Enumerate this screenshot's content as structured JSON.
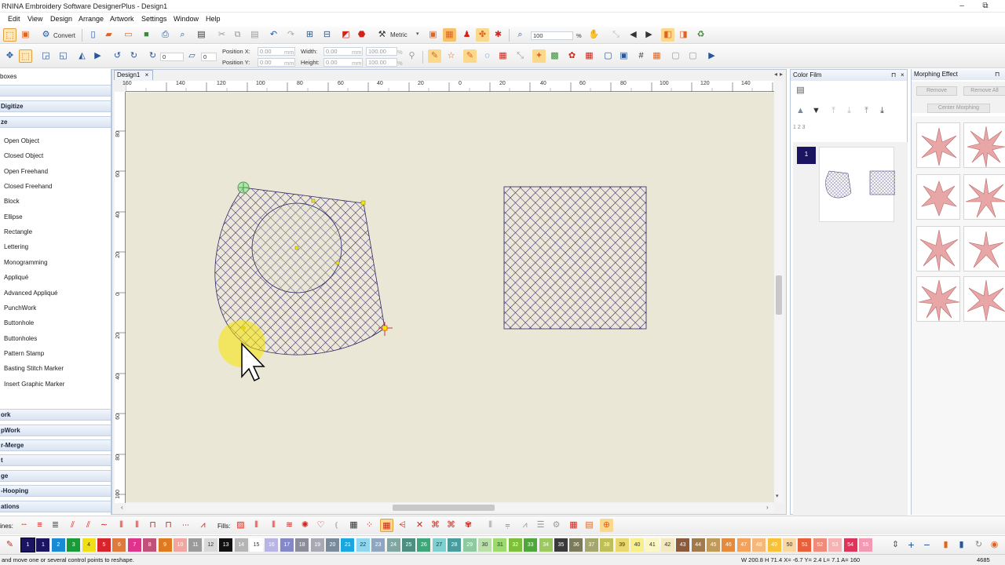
{
  "window": {
    "title": "RNINA Embroidery Software DesignerPlus - Design1",
    "minimize": "–",
    "restore": "⧉"
  },
  "menu": [
    "Edit",
    "View",
    "Design",
    "Arrange",
    "Artwork",
    "Settings",
    "Window",
    "Help"
  ],
  "toolbar1": {
    "convert_label": "Convert",
    "units": "Metric",
    "zoom": "100",
    "zoom_unit": "%"
  },
  "toolbar2": {
    "angle_value": "0",
    "angle2_value": "0",
    "position_x_label": "Position X:",
    "position_y_label": "Position Y:",
    "position_x": "0.00",
    "position_y": "0.00",
    "pos_unit": "mm",
    "width_label": "Width:",
    "height_label": "Height:",
    "width": "0.00",
    "height": "0.00",
    "size_unit": "mm",
    "width_pct": "100.00",
    "height_pct": "100.00",
    "pct": "%"
  },
  "left_panel": {
    "header_top": "boxes",
    "sections": [
      "Digitize",
      "ze"
    ],
    "items": [
      "Open Object",
      "Closed Object",
      "Open Freehand",
      "Closed Freehand",
      "Block",
      "Ellipse",
      "Rectangle",
      "Lettering",
      "Monogramming",
      "Appliqué",
      "Advanced Appliqué",
      "PunchWork",
      "Buttonhole",
      "Buttonholes",
      "Pattern Stamp",
      "Basting Stitch Marker",
      "Insert Graphic Marker"
    ],
    "bottom_sections": [
      "ork",
      "pWork",
      "r-Merge",
      "t",
      "ge",
      "-Hooping",
      "ations"
    ]
  },
  "document_tab": {
    "label": "Design1",
    "close": "×"
  },
  "rulers": {
    "h": [
      "160",
      "140",
      "120",
      "100",
      "80",
      "60",
      "40",
      "20",
      "0",
      "20",
      "40",
      "60",
      "80",
      "100",
      "120",
      "140"
    ],
    "v": [
      "80",
      "60",
      "40",
      "20",
      "0",
      "20",
      "40",
      "60",
      "80",
      "100"
    ]
  },
  "color_film": {
    "title": "Color Film",
    "pin": "⊓",
    "close": "×",
    "number_label": "1 2 3",
    "item_number": "1"
  },
  "morphing": {
    "title": "Morphing Effect",
    "remove": "Remove",
    "remove_all": "Remove All",
    "center_morphing": "Center Morphing"
  },
  "bottom_toolbar": {
    "lines_label": "ines:",
    "fills_label": "Fills:"
  },
  "palette": {
    "swatches": [
      {
        "n": "1",
        "c": "#1b1561"
      },
      {
        "n": "1",
        "c": "#1b1561"
      },
      {
        "n": "2",
        "c": "#1a8ad4"
      },
      {
        "n": "3",
        "c": "#1a9b3a"
      },
      {
        "n": "4",
        "c": "#f1df16"
      },
      {
        "n": "5",
        "c": "#d8232a"
      },
      {
        "n": "6",
        "c": "#e07a3c"
      },
      {
        "n": "7",
        "c": "#e0338b"
      },
      {
        "n": "8",
        "c": "#c0527a"
      },
      {
        "n": "9",
        "c": "#e07a21"
      },
      {
        "n": "10",
        "c": "#f2a6a0"
      },
      {
        "n": "11",
        "c": "#9a9a9a"
      },
      {
        "n": "12",
        "c": "#d9d9d9"
      },
      {
        "n": "13",
        "c": "#111111"
      },
      {
        "n": "14",
        "c": "#b5b5b5"
      },
      {
        "n": "15",
        "c": "#ffffff"
      },
      {
        "n": "16",
        "c": "#b8b4e6"
      },
      {
        "n": "17",
        "c": "#8588c8"
      },
      {
        "n": "18",
        "c": "#8d8d9a"
      },
      {
        "n": "19",
        "c": "#a9a9b4"
      },
      {
        "n": "20",
        "c": "#7a8a9a"
      },
      {
        "n": "21",
        "c": "#1aa7df"
      },
      {
        "n": "22",
        "c": "#8fd6ef"
      },
      {
        "n": "23",
        "c": "#8ea6bf"
      },
      {
        "n": "24",
        "c": "#7fa6a0"
      },
      {
        "n": "25",
        "c": "#4f8d80"
      },
      {
        "n": "26",
        "c": "#3fa67a"
      },
      {
        "n": "27",
        "c": "#7ed1d0"
      },
      {
        "n": "28",
        "c": "#4a9b9b"
      },
      {
        "n": "29",
        "c": "#8fc9a0"
      },
      {
        "n": "30",
        "c": "#b8e0a8"
      },
      {
        "n": "31",
        "c": "#9cd96f"
      },
      {
        "n": "32",
        "c": "#7bbf3a"
      },
      {
        "n": "33",
        "c": "#4fa63a"
      },
      {
        "n": "34",
        "c": "#9bc95f"
      },
      {
        "n": "35",
        "c": "#3a3a3a"
      },
      {
        "n": "36",
        "c": "#7b7b5a"
      },
      {
        "n": "37",
        "c": "#a5a56e"
      },
      {
        "n": "38",
        "c": "#bfbf5a"
      },
      {
        "n": "39",
        "c": "#e8d86e"
      },
      {
        "n": "40",
        "c": "#f6ef8a"
      },
      {
        "n": "41",
        "c": "#fbf7c4"
      },
      {
        "n": "42",
        "c": "#f4e8bf"
      },
      {
        "n": "43",
        "c": "#8a5a3a"
      },
      {
        "n": "44",
        "c": "#a07a4a"
      },
      {
        "n": "45",
        "c": "#c09a5a"
      },
      {
        "n": "46",
        "c": "#e58a3a"
      },
      {
        "n": "47",
        "c": "#f3a25a"
      },
      {
        "n": "48",
        "c": "#f6b87a"
      },
      {
        "n": "49",
        "c": "#f7c23a"
      },
      {
        "n": "50",
        "c": "#f9d7a0"
      },
      {
        "n": "51",
        "c": "#e8603a"
      },
      {
        "n": "52",
        "c": "#f08a7a"
      },
      {
        "n": "53",
        "c": "#f6b3b3"
      },
      {
        "n": "54",
        "c": "#e0335a"
      },
      {
        "n": "55",
        "c": "#f29ab3"
      }
    ]
  },
  "status": {
    "hint": "and move one or several control points to reshape.",
    "coords": "W 200.8 H 71.4    X= -6.7 Y= 2.4 L= 7.1 A= 160",
    "count": "4685"
  },
  "colors": {
    "canvas": "#ebe7d6",
    "stitch": "#2b2566",
    "panel_header": "#d9e3f1",
    "highlight": "#f7e600"
  }
}
